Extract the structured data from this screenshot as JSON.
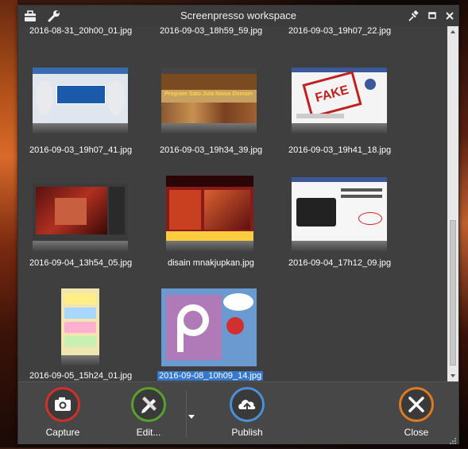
{
  "window": {
    "title": "Screenpresso workspace"
  },
  "titlebar_icons": {
    "left": [
      "briefcase-icon",
      "wrench-icon"
    ],
    "right": [
      "pin-icon",
      "maximize-icon",
      "close-icon"
    ]
  },
  "thumbnails": [
    {
      "label": "2016-08-31_20h00_01.jpg",
      "selected": false
    },
    {
      "label": "2016-09-03_18h59_59.jpg",
      "selected": false
    },
    {
      "label": "2016-09-03_19h07_22.jpg",
      "selected": false
    },
    {
      "label": "2016-09-03_19h07_41.jpg",
      "selected": false
    },
    {
      "label": "2016-09-03_19h34_39.jpg",
      "selected": false,
      "banner_text": "Program Satu Juta Nama Domain"
    },
    {
      "label": "2016-09-03_19h41_18.jpg",
      "selected": false,
      "stamp_text": "FAKE"
    },
    {
      "label": "2016-09-04_13h54_05.jpg",
      "selected": false
    },
    {
      "label": "disain mnakjupkan.jpg",
      "selected": false
    },
    {
      "label": "2016-09-04_17h12_09.jpg",
      "selected": false
    },
    {
      "label": "2016-09-05_15h24_01.jpg",
      "selected": false
    },
    {
      "label": "2016-09-08_10h09_14.jpg",
      "selected": true
    }
  ],
  "toolbar": {
    "capture": "Capture",
    "edit": "Edit...",
    "publish": "Publish",
    "close": "Close"
  },
  "colors": {
    "capture": "#d0302a",
    "edit": "#5aa02a",
    "publish": "#4a90d8",
    "close": "#e07a20",
    "selection": "#3478d0"
  }
}
